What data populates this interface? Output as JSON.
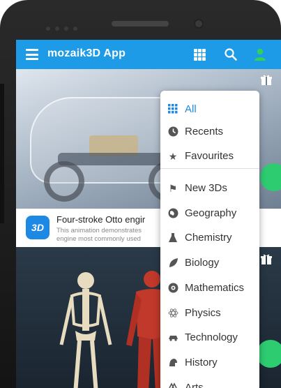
{
  "app": {
    "title": "mozaik3D App"
  },
  "cards": [
    {
      "badge": "3D",
      "title": "Four-stroke Otto engir",
      "description": "This animation demonstrates engine most commonly used"
    }
  ],
  "menu": {
    "primary": [
      {
        "label": "All",
        "icon": "grid-icon",
        "active": true
      },
      {
        "label": "Recents",
        "icon": "clock-icon"
      },
      {
        "label": "Favourites",
        "icon": "star-icon"
      }
    ],
    "categories": [
      {
        "label": "New 3Ds",
        "icon": "flag-icon"
      },
      {
        "label": "Geography",
        "icon": "globe-icon"
      },
      {
        "label": "Chemistry",
        "icon": "flask-icon"
      },
      {
        "label": "Biology",
        "icon": "leaf-icon"
      },
      {
        "label": "Mathematics",
        "icon": "math-icon"
      },
      {
        "label": "Physics",
        "icon": "atom-icon"
      },
      {
        "label": "Technology",
        "icon": "car-icon"
      },
      {
        "label": "History",
        "icon": "helmet-icon"
      },
      {
        "label": "Arts",
        "icon": "palette-icon"
      }
    ]
  },
  "colors": {
    "app_bar": "#1e9be6",
    "accent": "#1e88e5",
    "fab": "#2ecc71"
  }
}
